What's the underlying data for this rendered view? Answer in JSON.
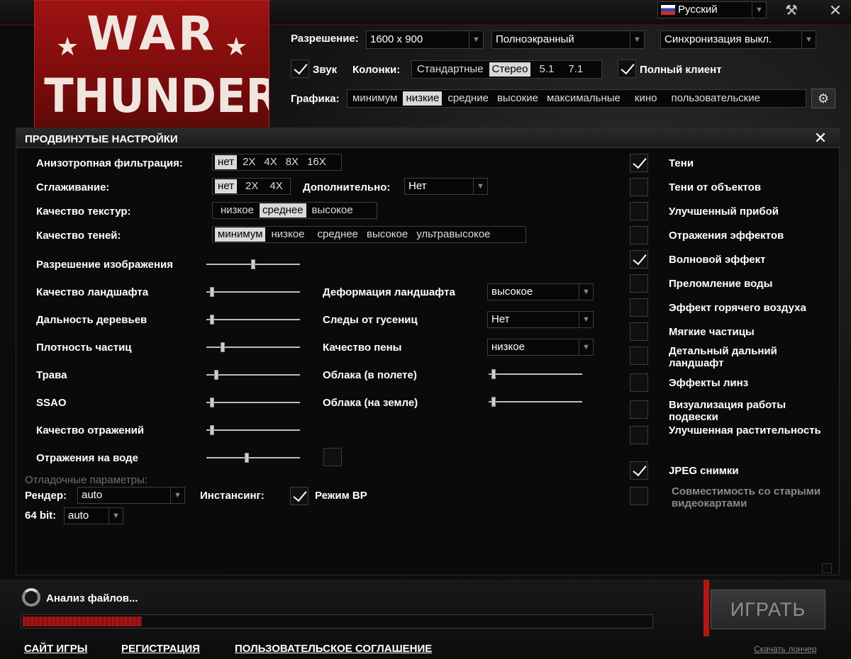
{
  "header": {
    "logo_text_top": "WAR",
    "logo_text_bottom": "THUNDER",
    "language": "Русский",
    "resolution_label": "Разрешение:",
    "resolution_value": "1600 x 900",
    "window_mode": "Полноэкранный",
    "vsync": "Синхронизация выкл.",
    "sound_label": "Звук",
    "speakers_label": "Колонки:",
    "speakers_options": [
      "Стандартные",
      "Стерео",
      "5.1",
      "7.1"
    ],
    "speakers_selected": "Стерео",
    "full_client_label": "Полный клиент",
    "graphics_label": "Графика:",
    "graphics_options": [
      "минимум",
      "низкие",
      "средние",
      "высокие",
      "максимальные",
      "кино",
      "пользовательские"
    ],
    "graphics_selected": "низкие"
  },
  "panel": {
    "title": "ПРОДВИНУТЫЕ НАСТРОЙКИ",
    "aniso_label": "Анизотропная фильтрация:",
    "aniso_options": [
      "нет",
      "2X",
      "4X",
      "8X",
      "16X"
    ],
    "aa_label": "Сглаживание:",
    "aa_options": [
      "нет",
      "2X",
      "4X"
    ],
    "extra_label": "Дополнительно:",
    "extra_value": "Нет",
    "texture_label": "Качество текстур:",
    "texture_options": [
      "низкое",
      "среднее",
      "высокое"
    ],
    "shadow_label": "Качество теней:",
    "shadow_options": [
      "минимум",
      "низкое",
      "среднее",
      "высокое",
      "ультравысокое"
    ],
    "sliders_left": [
      {
        "label": "Разрешение изображения",
        "value": 0.5
      },
      {
        "label": "Качество ландшафта",
        "value": 0.04
      },
      {
        "label": "Дальность деревьев",
        "value": 0.04
      },
      {
        "label": "Плотность частиц",
        "value": 0.16
      },
      {
        "label": "Трава",
        "value": 0.09
      },
      {
        "label": "SSAO",
        "value": 0.04
      },
      {
        "label": "Качество отражений",
        "value": 0.04
      },
      {
        "label": "Отражения на воде",
        "value": 0.43
      }
    ],
    "mid_dropdowns": [
      {
        "label": "Деформация ландшафта",
        "value": "высокое"
      },
      {
        "label": "Следы от гусениц",
        "value": "Нет"
      },
      {
        "label": "Качество пены",
        "value": "низкое"
      }
    ],
    "mid_sliders": [
      {
        "label": "Облака (в полете)",
        "value": 0.03
      },
      {
        "label": "Облака (на земле)",
        "value": 0.03
      }
    ],
    "debug_label": "Отладочные параметры:",
    "render_label": "Рендер:",
    "render_value": "auto",
    "instancing_label": "Инстансинг:",
    "vr_label": "Режим ВР",
    "bit64_label": "64 bit:",
    "bit64_value": "auto",
    "checkboxes": [
      {
        "label": "Тени",
        "checked": true
      },
      {
        "label": "Тени от объектов",
        "checked": false
      },
      {
        "label": "Улучшенный прибой",
        "checked": false
      },
      {
        "label": "Отражения эффектов",
        "checked": false
      },
      {
        "label": "Волновой эффект",
        "checked": true
      },
      {
        "label": "Преломление воды",
        "checked": false
      },
      {
        "label": "Эффект горячего воздуха",
        "checked": false
      },
      {
        "label": "Мягкие частицы",
        "checked": false
      },
      {
        "label": "Детальный дальний ландшафт",
        "checked": false
      },
      {
        "label": "Эффекты линз",
        "checked": false
      },
      {
        "label": "Визуализация работы подвески",
        "checked": false
      },
      {
        "label": "Улучшенная растительность",
        "checked": false
      },
      {
        "label": "JPEG снимки",
        "checked": true
      },
      {
        "label": "Совместимость со старыми видеокартами",
        "checked": false
      }
    ]
  },
  "footer": {
    "status": "Анализ файлов...",
    "progress": 0.19,
    "play": "ИГРАТЬ",
    "links": [
      "САЙТ ИГРЫ",
      "РЕГИСТРАЦИЯ",
      "ПОЛЬЗОВАТЕЛЬСКОЕ СОГЛАШЕНИЕ"
    ],
    "download_link": "Скачать лончер"
  }
}
